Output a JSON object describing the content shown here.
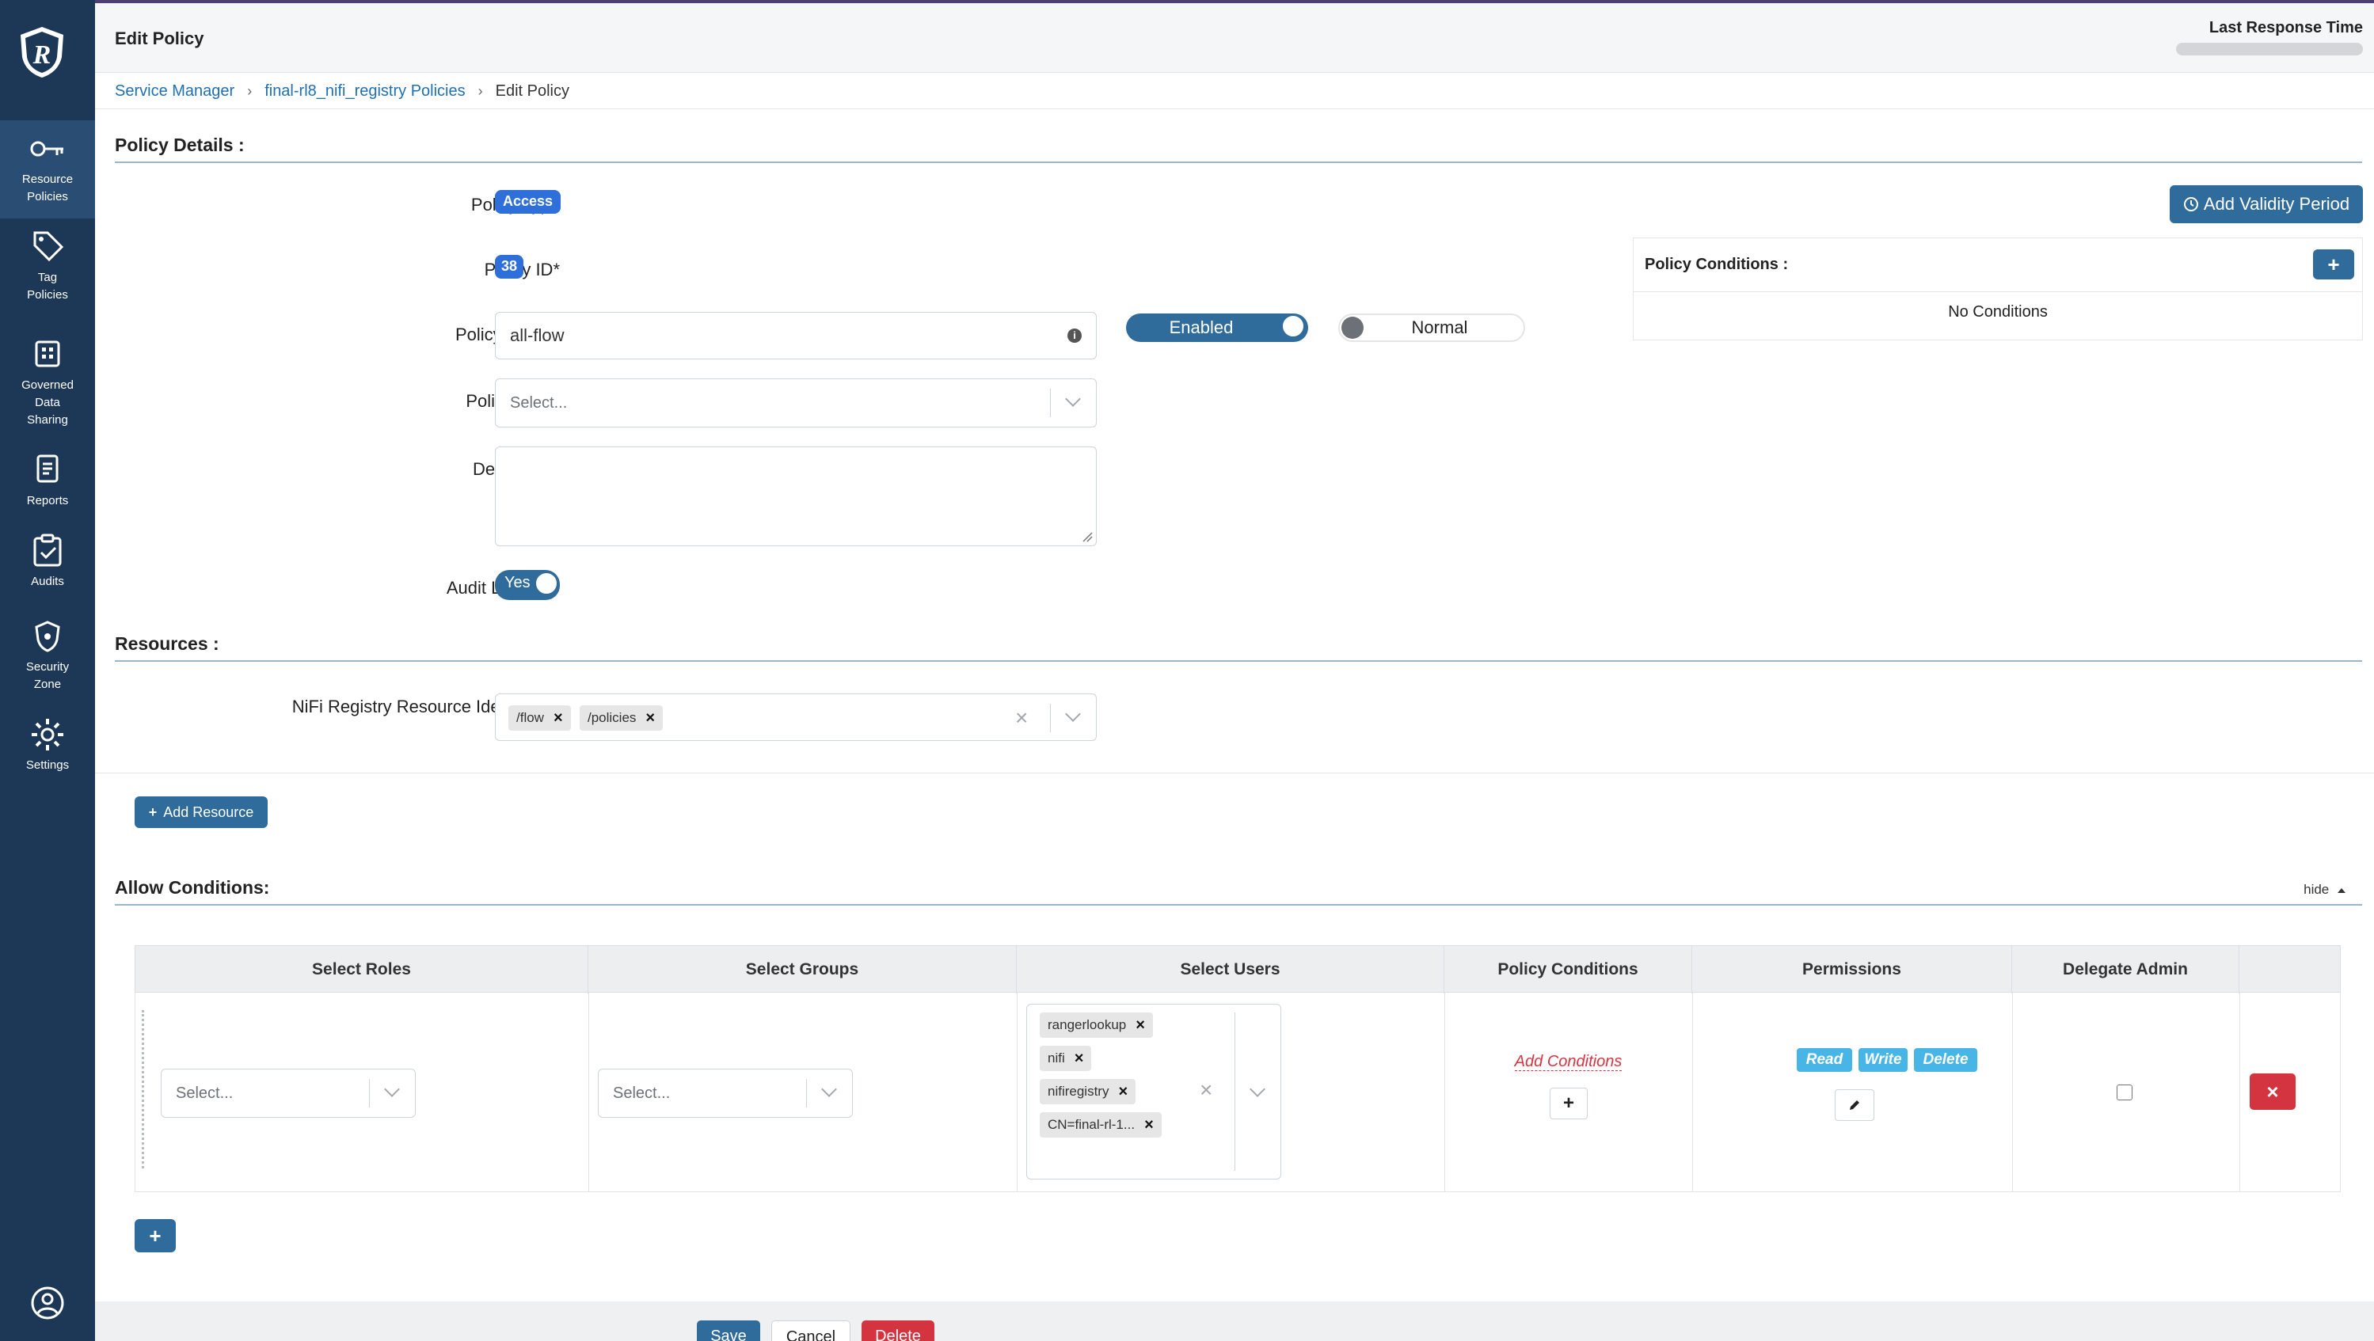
{
  "sidebar": {
    "items": [
      {
        "label_1": "Resource",
        "label_2": "Policies",
        "icon": "key-icon"
      },
      {
        "label_1": "Tag",
        "label_2": "Policies",
        "icon": "tag-icon"
      },
      {
        "label_1": "Governed",
        "label_2": "Data",
        "label_3": "Sharing",
        "icon": "grid-icon"
      },
      {
        "label_1": "Reports",
        "icon": "report-icon"
      },
      {
        "label_1": "Audits",
        "icon": "clipboard-check-icon"
      },
      {
        "label_1": "Security",
        "label_2": "Zone",
        "icon": "shield-lock-icon"
      },
      {
        "label_1": "Settings",
        "icon": "gear-icon"
      }
    ]
  },
  "header": {
    "title": "Edit Policy",
    "last_response_label": "Last Response Time"
  },
  "breadcrumb": {
    "item1": "Service Manager",
    "item2": "final-rl8_nifi_registry Policies",
    "item3": "Edit Policy"
  },
  "policy_details": {
    "section_title": "Policy Details :",
    "policy_type_label": "Policy Type",
    "policy_type_value": "Access",
    "policy_id_label": "Policy ID*",
    "policy_id_value": "38",
    "policy_name_label": "Policy Name*",
    "policy_name_value": "all-flow",
    "enabled_label": "Enabled",
    "normal_label": "Normal",
    "policy_label_label": "Policy Label",
    "policy_label_placeholder": "Select...",
    "description_label": "Description",
    "audit_logging_label": "Audit Logging*",
    "audit_logging_value": "Yes",
    "add_validity_label": "Add Validity Period",
    "policy_conditions_title": "Policy Conditions :",
    "no_conditions": "No Conditions"
  },
  "resources": {
    "section_title": "Resources :",
    "identifier_label": "NiFi Registry Resource Identifier*",
    "values": [
      "/flow",
      "/policies"
    ],
    "add_resource_label": "Add Resource"
  },
  "allow_conditions": {
    "section_title": "Allow Conditions:",
    "hide_label": "hide",
    "columns": [
      "Select Roles",
      "Select Groups",
      "Select Users",
      "Policy Conditions",
      "Permissions",
      "Delegate Admin"
    ],
    "roles_placeholder": "Select...",
    "groups_placeholder": "Select...",
    "users": [
      "rangerlookup",
      "nifi",
      "nifiregistry",
      "CN=final-rl-1..."
    ],
    "add_conditions_label": "Add Conditions",
    "permissions": [
      "Read",
      "Write",
      "Delete"
    ],
    "delegate_admin_checked": false
  },
  "footer": {
    "save_label": "Save",
    "cancel_label": "Cancel",
    "delete_label": "Delete"
  },
  "colors": {
    "sidebar_bg": "#1d3857",
    "primary": "#2f6c9c",
    "badge_blue": "#2f6fd9",
    "danger": "#d3343f",
    "perm_tag": "#47b5e6"
  }
}
